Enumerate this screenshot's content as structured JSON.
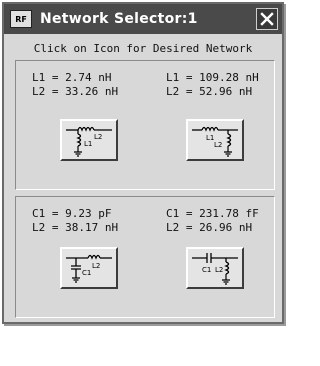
{
  "window": {
    "title": "Network Selector:1",
    "app_icon_text": "RF"
  },
  "instruction": "Click on Icon for Desired Network",
  "networks": [
    {
      "line1": "L1 = 2.74 nH",
      "line2": "L2 = 33.26 nH",
      "icon": "shunt-l1-series-l2-network-icon",
      "labels": [
        "L2",
        "L1"
      ]
    },
    {
      "line1": "L1 = 109.28 nH",
      "line2": "L2 = 52.96 nH",
      "icon": "series-l1-shunt-l2-network-icon",
      "labels": [
        "L1",
        "L2"
      ]
    },
    {
      "line1": "C1 = 9.23 pF",
      "line2": "L2 = 38.17 nH",
      "icon": "shunt-c1-series-l2-network-icon",
      "labels": [
        "L2",
        "C1"
      ]
    },
    {
      "line1": "C1 = 231.78 fF",
      "line2": "L2 = 26.96 nH",
      "icon": "series-c1-shunt-l2-network-icon",
      "labels": [
        "C1",
        "L2"
      ]
    }
  ],
  "colors": {
    "titlebar": "#4a4a4a",
    "window": "#d8d8d8"
  }
}
